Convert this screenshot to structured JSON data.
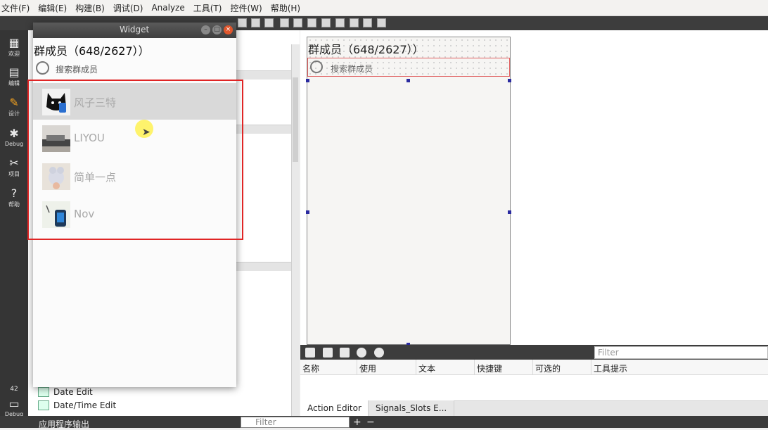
{
  "menubar": {
    "items": [
      "文件(F)",
      "编辑(E)",
      "构建(B)",
      "调试(D)",
      "Analyze",
      "工具(T)",
      "控件(W)",
      "帮助(H)"
    ]
  },
  "modebar": {
    "modes": [
      {
        "label": "欢迎",
        "icon": "grid-icon"
      },
      {
        "label": "编辑",
        "icon": "document-icon"
      },
      {
        "label": "设计",
        "icon": "pencil-icon"
      },
      {
        "label": "Debug",
        "icon": "bug-icon"
      },
      {
        "label": "项目",
        "icon": "wrench-icon"
      },
      {
        "label": "帮助",
        "icon": "help-icon"
      }
    ],
    "counter": "42",
    "bottom_label": "Debug"
  },
  "widgetbox": {
    "items": [
      "Date Edit",
      "Date/Time Edit"
    ]
  },
  "widget_window": {
    "title": "Widget",
    "group_title": "群成员（648/2627））",
    "search_placeholder": "搜索群成员",
    "members": [
      {
        "name": "风子三特"
      },
      {
        "name": "LIYOU"
      },
      {
        "name": "简单一点"
      },
      {
        "name": "Nov"
      }
    ]
  },
  "form": {
    "group_title": "群成员（648/2627））",
    "search_placeholder": "搜索群成员"
  },
  "action_editor": {
    "filter_placeholder": "Filter",
    "columns": [
      "名称",
      "使用",
      "文本",
      "快捷键",
      "可选的",
      "工具提示"
    ],
    "tabs": [
      "Action Editor",
      "Signals_Slots E..."
    ]
  },
  "bottombar": {
    "title": "应用程序输出",
    "filter_placeholder": "Filter"
  },
  "colors": {
    "selection_border": "#e02525",
    "form_search_border": "#e06060"
  }
}
